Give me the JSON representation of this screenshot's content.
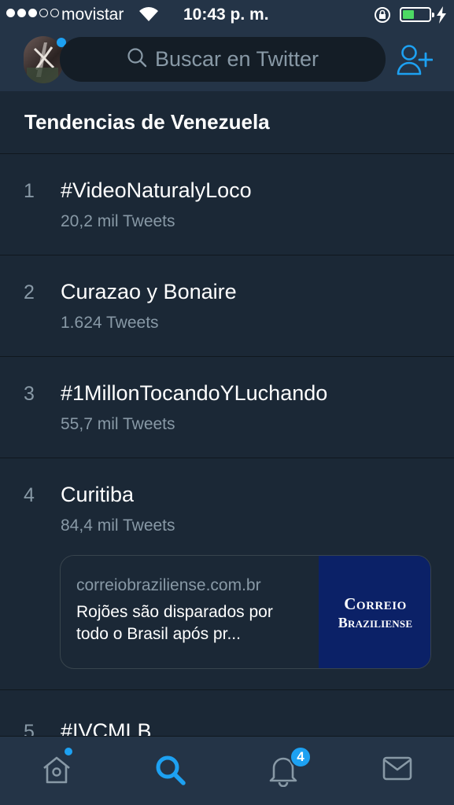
{
  "status_bar": {
    "carrier": "movistar",
    "time": "10:43 p. m.",
    "signal_bars_filled": 3,
    "signal_bars_total": 5,
    "battery_color": "#4cd964"
  },
  "header": {
    "search_placeholder": "Buscar en Twitter",
    "search_icon": "search-icon",
    "add_user_icon": "add-user-icon"
  },
  "section": {
    "title": "Tendencias de Venezuela"
  },
  "trends": [
    {
      "rank": "1",
      "name": "#VideoNaturalyLoco",
      "count": "20,2 mil Tweets"
    },
    {
      "rank": "2",
      "name": "Curazao y Bonaire",
      "count": "1.624 Tweets"
    },
    {
      "rank": "3",
      "name": "#1MillonTocandoYLuchando",
      "count": "55,7 mil Tweets"
    },
    {
      "rank": "4",
      "name": "Curitiba",
      "count": "84,4 mil Tweets",
      "card": {
        "domain": "correiobraziliense.com.br",
        "headline": "Rojões são disparados por todo o Brasil após pr...",
        "thumb_line1": "Correio",
        "thumb_line2": "Braziliense"
      }
    },
    {
      "rank": "5",
      "name": "#IVCMLB",
      "count": ""
    }
  ],
  "tabbar": {
    "tabs": [
      "home",
      "search",
      "notifications",
      "messages"
    ],
    "active": "search",
    "notifications_badge": "4",
    "accent": "#1da1f2"
  }
}
